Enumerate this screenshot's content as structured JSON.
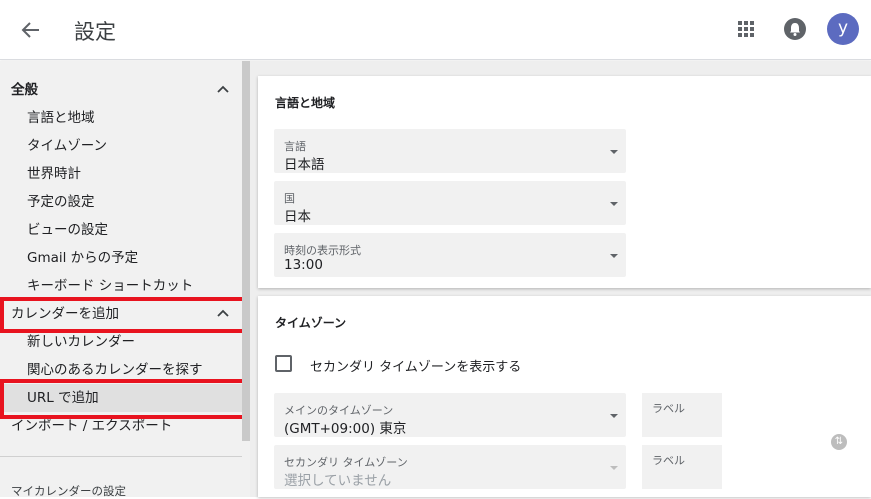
{
  "header": {
    "title": "設定",
    "back_icon": "arrow-left-icon",
    "apps_icon": "apps-grid-icon",
    "notification_icon": "bell-icon",
    "avatar_letter": "y",
    "avatar_color": "#5c6bc0"
  },
  "sidebar": {
    "general": {
      "label": "全般",
      "icon": "chevron-up-icon"
    },
    "general_items": [
      "言語と地域",
      "タイムゾーン",
      "世界時計",
      "予定の設定",
      "ビューの設定",
      "Gmail からの予定",
      "キーボード ショートカット"
    ],
    "add_calendar": {
      "label": "カレンダーを追加",
      "icon": "chevron-up-icon"
    },
    "add_calendar_items": [
      "新しいカレンダー",
      "関心のあるカレンダーを探す",
      "URL で追加"
    ],
    "import_export": "インポート / エクスポート",
    "my_calendars": "マイカレンダーの設定",
    "highlight_color": "#e8131f"
  },
  "language_region": {
    "title": "言語と地域",
    "fields": [
      {
        "label": "言語",
        "value": "日本語"
      },
      {
        "label": "国",
        "value": "日本"
      },
      {
        "label": "時刻の表示形式",
        "value": "13:00"
      }
    ]
  },
  "timezone": {
    "title": "タイムゾーン",
    "secondary_checkbox_label": "セカンダリ タイムゾーンを表示する",
    "primary": {
      "label": "メインのタイムゾーン",
      "value": "(GMT+09:00) 東京",
      "label_field": "ラベル"
    },
    "secondary": {
      "label": "セカンダリ タイムゾーン",
      "value": "選択していません",
      "label_field": "ラベル"
    }
  },
  "help_icon": "swap-icon"
}
